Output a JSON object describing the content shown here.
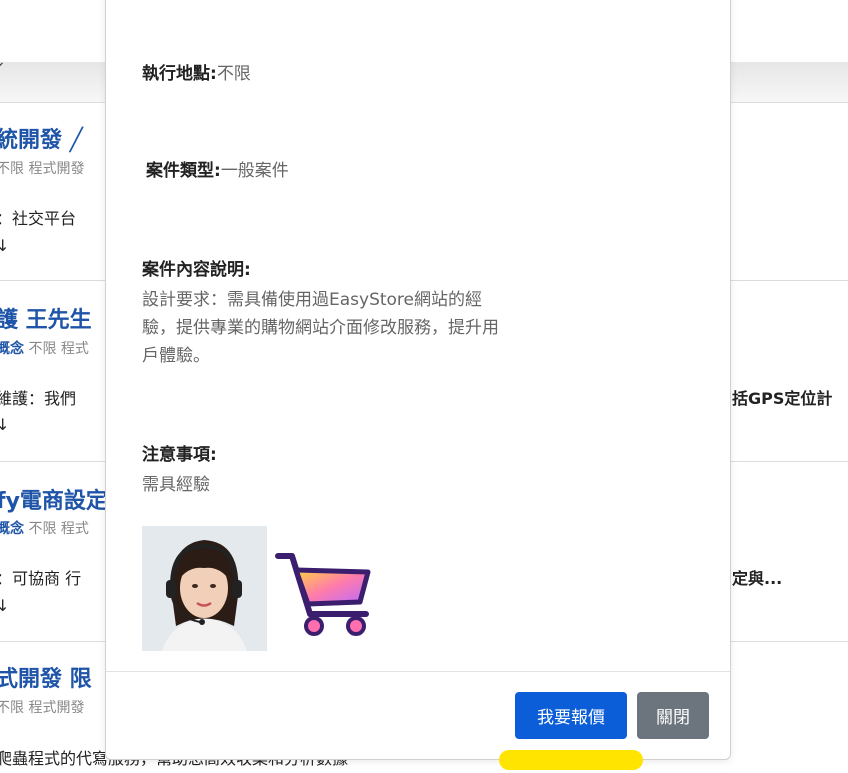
{
  "background": {
    "band_text": "⌄",
    "listings": [
      {
        "title": "統開發 ╱",
        "meta_plain": "不限 程式開發",
        "meta_blue": "",
        "desc": "：社交平台",
        "line2": "↓"
      },
      {
        "title": "護 王先生",
        "meta_blue": "概念",
        "meta_plain": " 不限 程式",
        "desc": "維護：我們",
        "right": "括GPS定位計",
        "line2": "↓"
      },
      {
        "title": "fy電商設定",
        "meta_blue": "概念",
        "meta_plain": " 不限 程式",
        "desc": "：可協商 行",
        "right": "定與...",
        "line2": "↓"
      },
      {
        "title": "式開發 限",
        "meta_plain": "不限 程式開發",
        "meta_blue": "",
        "desc": "爬蟲程式的代寫服務，幫助您高效收集和分析數據"
      }
    ]
  },
  "modal": {
    "location": {
      "label": "執行地點:",
      "value": "不限"
    },
    "case_type": {
      "label": "案件類型:",
      "value": "一般案件"
    },
    "description": {
      "label": "案件內容說明:",
      "lines": [
        "設計要求：需具備使用過EasyStore網站的經",
        "驗，提供專業的購物網站介面修改服務，提升用",
        "戶體驗。"
      ]
    },
    "notes": {
      "label": "注意事項:",
      "value": "需具經驗"
    },
    "images": [
      {
        "icon": "customer-service-avatar"
      },
      {
        "icon": "shopping-cart-icon"
      }
    ],
    "buttons": {
      "quote": "我要報價",
      "close": "關閉"
    },
    "colors": {
      "primary": "#0b5ed7",
      "secondary": "#6c757d",
      "accent": "#ffe400"
    }
  }
}
